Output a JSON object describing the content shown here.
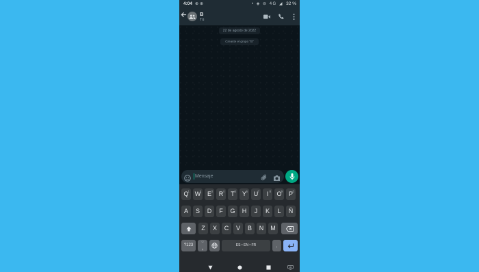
{
  "status_bar": {
    "time": "4:04",
    "network": "4G",
    "battery": "32 %"
  },
  "header": {
    "title": "B",
    "subtitle": "Tú"
  },
  "chat": {
    "date_chip": "22 de agosto de 2022",
    "system_message": "Creaste el grupo \"B\""
  },
  "composer": {
    "placeholder": "Mensaje"
  },
  "keyboard": {
    "row1": [
      {
        "key": "Q",
        "hint": "1"
      },
      {
        "key": "W",
        "hint": "2"
      },
      {
        "key": "E",
        "hint": "3"
      },
      {
        "key": "R",
        "hint": "4"
      },
      {
        "key": "T",
        "hint": "5"
      },
      {
        "key": "Y",
        "hint": "6"
      },
      {
        "key": "U",
        "hint": "7"
      },
      {
        "key": "I",
        "hint": "8"
      },
      {
        "key": "O",
        "hint": "9"
      },
      {
        "key": "P",
        "hint": "0"
      }
    ],
    "row2": [
      "A",
      "S",
      "D",
      "F",
      "G",
      "H",
      "J",
      "K",
      "L",
      "Ñ"
    ],
    "row3": [
      "Z",
      "X",
      "C",
      "V",
      "B",
      "N",
      "M"
    ],
    "symbols_label": "?123",
    "comma_label": ",",
    "comma_hint": "☺",
    "space_label": "ES • EN • FR",
    "period_label": "."
  },
  "colors": {
    "page_background": "#3bb8f0",
    "header_background": "#1f2c34",
    "chat_background": "#0b141a",
    "accent_green": "#00a884",
    "key_background": "#3c4043",
    "enter_key": "#8ab4f8"
  },
  "icons": {
    "back": "arrow-left-icon",
    "avatar": "group-icon",
    "video_call": "video-camera-icon",
    "voice_call": "phone-icon",
    "menu": "more-vertical-icon",
    "emoji": "emoji-icon",
    "attach": "paperclip-icon",
    "camera": "camera-icon",
    "mic": "microphone-icon",
    "shift": "shift-icon",
    "backspace": "backspace-icon",
    "globe": "globe-icon",
    "enter": "enter-icon",
    "nav_back": "triangle-back-icon",
    "nav_home": "circle-home-icon",
    "nav_recents": "square-recents-icon",
    "nav_keyboard": "keyboard-icon"
  }
}
